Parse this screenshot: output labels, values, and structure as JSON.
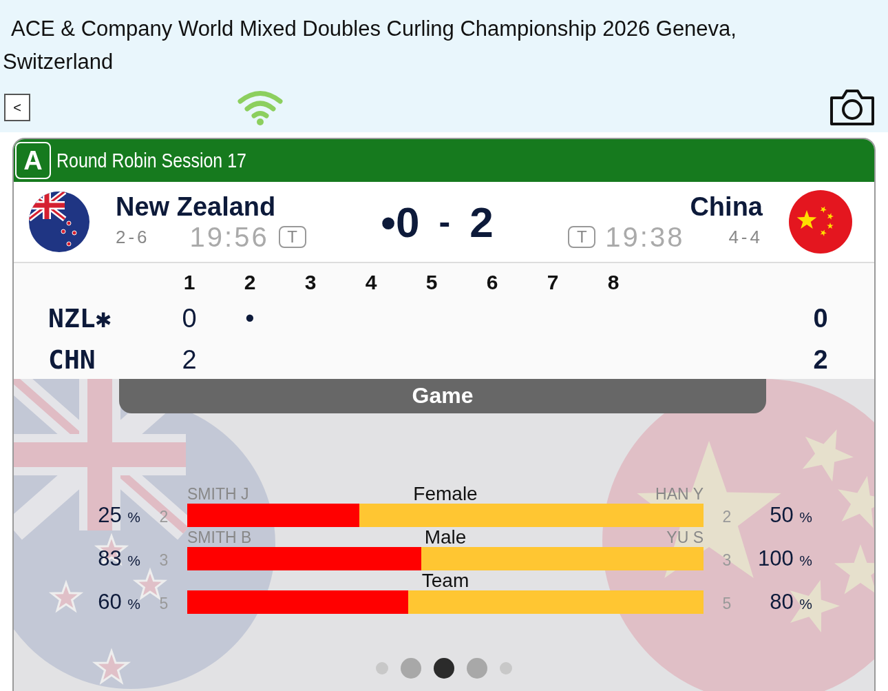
{
  "header": {
    "title": "ACE & Company World Mixed Doubles Curling Championship 2026 Geneva, Switzerland",
    "back_button": "<"
  },
  "match": {
    "sheet": "A",
    "session": "Round Robin Session 17",
    "teams": [
      {
        "name": "New Zealand",
        "record": "2-6",
        "time": "19:56",
        "timeout": "T"
      },
      {
        "name": "China",
        "record": "4-4",
        "time": "19:38",
        "timeout": "T"
      }
    ],
    "score": {
      "hammer": "•",
      "home": "0",
      "separator": "-",
      "away": "2"
    }
  },
  "linescore": {
    "ends": [
      "1",
      "2",
      "3",
      "4",
      "5",
      "6",
      "7",
      "8"
    ],
    "rows": [
      {
        "team": "NZL",
        "hammer": "✱",
        "ends": [
          "0",
          "•"
        ],
        "total": "0"
      },
      {
        "team": "CHN",
        "ends": [
          "2"
        ],
        "total": "2"
      }
    ]
  },
  "panel": {
    "title": "Game",
    "stats": [
      {
        "label": "Female",
        "left_name": "SMITH J",
        "right_name": "HAN Y",
        "left_pct": "25 %",
        "left_count": "2",
        "right_count": "2",
        "right_pct": "50 %",
        "level": 0.333
      },
      {
        "label": "Male",
        "left_name": "SMITH B",
        "right_name": "YU S",
        "left_pct": "83 %",
        "left_count": "3",
        "right_count": "3",
        "right_pct": "100 %",
        "level": 0.453
      },
      {
        "label": "Team",
        "left_pct": "60 %",
        "left_count": "5",
        "right_count": "5",
        "right_pct": "80 %",
        "level": 0.428
      }
    ],
    "pages": [
      {
        "selected": false
      },
      {
        "selected": false
      },
      {
        "selected": true
      },
      {
        "selected": false
      },
      {
        "selected": false
      }
    ]
  }
}
